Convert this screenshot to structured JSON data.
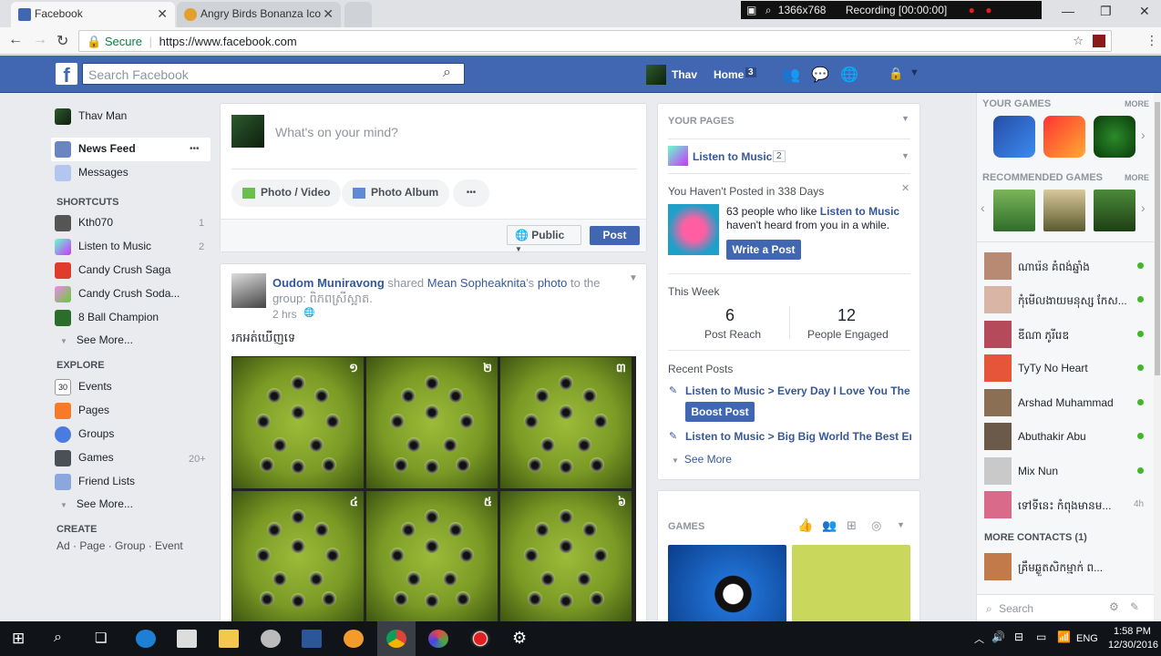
{
  "browser": {
    "tabs": [
      {
        "title": "Facebook",
        "active": true
      },
      {
        "title": "Angry Birds Bonanza Ico",
        "active": false
      }
    ],
    "recorder": {
      "resolution": "1366x768",
      "status": "Recording [00:00:00]"
    },
    "secure_label": "Secure",
    "url": "https://www.facebook.com"
  },
  "header": {
    "logo": "f",
    "search_placeholder": "Search Facebook",
    "profile_name": "Thav",
    "home_label": "Home",
    "home_count": "3"
  },
  "left_nav": {
    "profile": "Thav Man",
    "news_feed": "News Feed",
    "more_dots": "•••",
    "messages": "Messages",
    "shortcuts_heading": "SHORTCUTS",
    "shortcuts": [
      {
        "label": "Kth070",
        "count": "1"
      },
      {
        "label": "Listen to Music",
        "count": "2"
      },
      {
        "label": "Candy Crush Saga",
        "count": ""
      },
      {
        "label": "Candy Crush Soda...",
        "count": ""
      },
      {
        "label": "8 Ball Champion",
        "count": ""
      }
    ],
    "see_more_1": "See More...",
    "explore_heading": "EXPLORE",
    "explore": [
      {
        "label": "Events",
        "count": ""
      },
      {
        "label": "Pages",
        "count": ""
      },
      {
        "label": "Groups",
        "count": ""
      },
      {
        "label": "Games",
        "count": "20+"
      },
      {
        "label": "Friend Lists",
        "count": ""
      }
    ],
    "see_more_2": "See More...",
    "create_heading": "CREATE",
    "create_links": "Ad · Page · Group · Event"
  },
  "composer": {
    "placeholder": "What's on your mind?",
    "photo_video": "Photo / Video",
    "photo_album": "Photo Album",
    "more": "•••",
    "privacy": "Public",
    "post": "Post"
  },
  "feed_post": {
    "author": "Oudom Muniravong",
    "shared": "shared",
    "original_author": "Mean Sopheaknita",
    "possessive": "'s",
    "photo_word": "photo",
    "to_the": "to the",
    "group_line": "group: ពិភពស្រីស្អាត.",
    "time": "2 hrs",
    "text": "រកអត់ឃើញទេ",
    "numbers": [
      "១",
      "២",
      "៣",
      "៤",
      "៥",
      "៦"
    ]
  },
  "pages_panel": {
    "heading": "YOUR PAGES",
    "page_name": "Listen to Music",
    "page_count": "2",
    "not_posted": "You Haven't Posted in 338 Days",
    "like_text_1": "63 people who like",
    "like_page": "Listen to Music",
    "like_text_2": "haven't heard from you in a while.",
    "write_post": "Write a Post",
    "this_week": "This Week",
    "post_reach_num": "6",
    "post_reach_label": "Post Reach",
    "engaged_num": "12",
    "engaged_label": "People Engaged",
    "recent_posts": "Recent Posts",
    "recent_1": "Listen to Music > Every Day I Love You The ...",
    "boost": "Boost Post",
    "recent_2": "Listen to Music > Big Big World The Best En...",
    "see_more": "See More"
  },
  "games_panel": {
    "heading": "GAMES"
  },
  "right_sidebar": {
    "your_games": "YOUR GAMES",
    "more_1": "MORE",
    "recommended": "RECOMMENDED GAMES",
    "more_2": "MORE",
    "contacts": [
      {
        "name": "ណារ៉េន គំពង់ឆ្នាំង",
        "status": ""
      },
      {
        "name": "កុំមើលងាយមនុស្ស កែស...",
        "status": ""
      },
      {
        "name": "ឌីណា ភូរីរេឌ",
        "status": ""
      },
      {
        "name": "TyTy No Heart",
        "status": ""
      },
      {
        "name": "Arshad Muhammad",
        "status": ""
      },
      {
        "name": "Abuthakir Abu",
        "status": ""
      },
      {
        "name": "Mix Nun",
        "status": ""
      },
      {
        "name": "ទៅទីនេះ កំពុងមានម...",
        "status": "4h"
      }
    ],
    "more_contacts": "MORE CONTACTS (1)",
    "more_contact_name": "គ្រឹមឆ្ងួតសិកម្មាក់ ព...",
    "search": "Search"
  },
  "taskbar": {
    "lang": "ENG",
    "time": "1:58 PM",
    "date": "12/30/2016"
  }
}
